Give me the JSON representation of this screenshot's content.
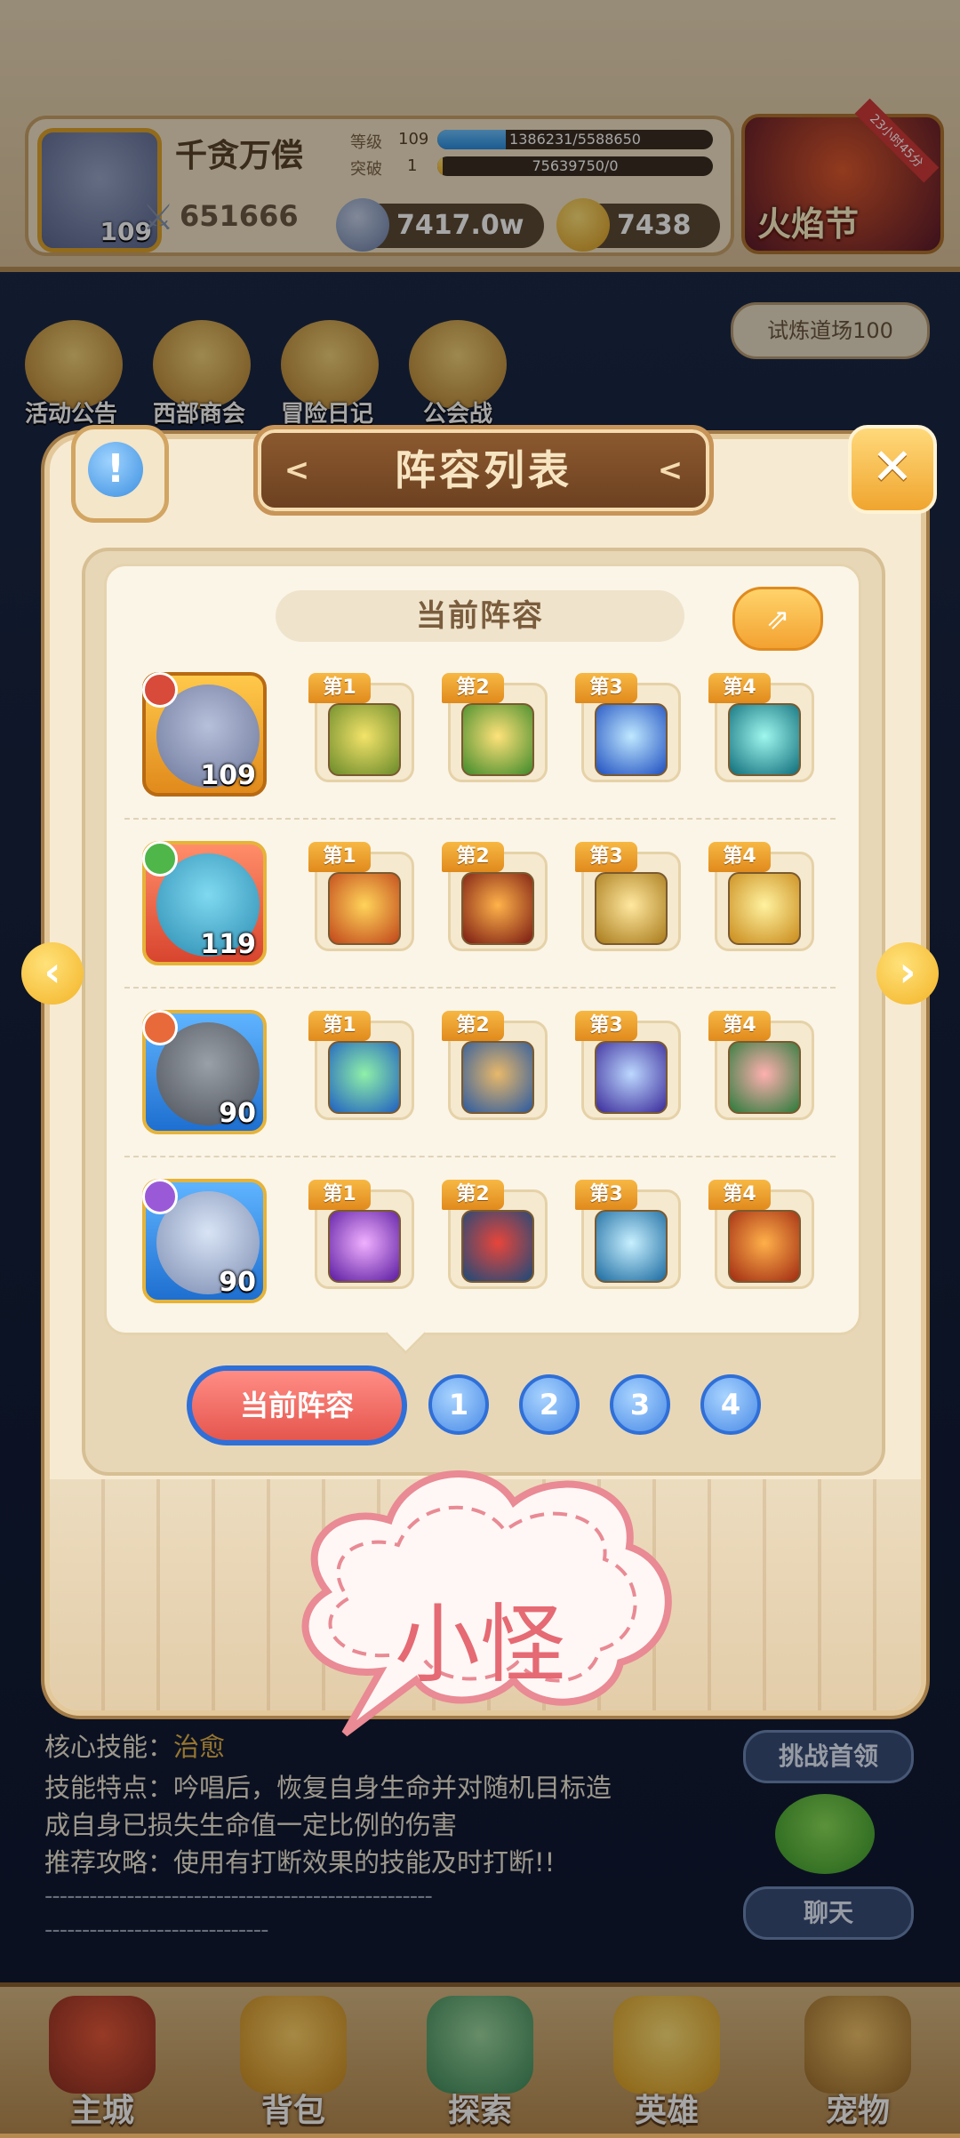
{
  "player": {
    "name": "千贪万偿",
    "avatar_level": "109",
    "level_label": "等级",
    "level_value": "109",
    "level_exp": "1386231/5588650",
    "level_progress": 0.248,
    "break_label": "突破",
    "break_value": "1",
    "break_exp": "75639750/0",
    "break_progress": 0.02,
    "power": "651666",
    "currency1": "7417.0w",
    "currency2": "7438"
  },
  "event": {
    "label": "火焰节",
    "timer": "23小时45分"
  },
  "top_icons": [
    "活动公告",
    "西部商会",
    "冒险日记",
    "公会战"
  ],
  "trial_label": "试炼道场100",
  "info_lines": {
    "skill_prefix": "核心技能：",
    "skill_value": "治愈",
    "feature": "技能特点：吟唱后，恢复自身生命并对随机目标造",
    "feature2": "成自身已损失生命值一定比例的伤害",
    "strategy": "推荐攻略：使用有打断效果的技能及时打断!!",
    "dashes1": "----------------------------------------------------",
    "dashes2": "------------------------------"
  },
  "side_buttons": {
    "challenge": "挑战首领",
    "chat": "聊天"
  },
  "bottom_nav": [
    "主城",
    "背包",
    "探索",
    "英雄",
    "宠物"
  ],
  "modal": {
    "title": "阵容列表",
    "info_symbol": "!",
    "close_symbol": "✕",
    "section_title": "当前阵容",
    "share_symbol": "⇗",
    "prev_arrow": "‹",
    "next_arrow": "›"
  },
  "lineup": [
    {
      "hero_level": "109",
      "skills": [
        "第1",
        "第2",
        "第3",
        "第4"
      ]
    },
    {
      "hero_level": "119",
      "skills": [
        "第1",
        "第2",
        "第3",
        "第4"
      ]
    },
    {
      "hero_level": "90",
      "skills": [
        "第1",
        "第2",
        "第3",
        "第4"
      ]
    },
    {
      "hero_level": "90",
      "skills": [
        "第1",
        "第2",
        "第3",
        "第4"
      ]
    }
  ],
  "pages": {
    "current": "当前阵容",
    "numbers": [
      "1",
      "2",
      "3",
      "4"
    ]
  },
  "tooltip": {
    "text": "小怪"
  },
  "colors": {
    "accent_orange": "#f3a231",
    "page_blue": "#2f6fd8",
    "current_red": "#e5564e",
    "cloud_pink": "#e56a73"
  }
}
